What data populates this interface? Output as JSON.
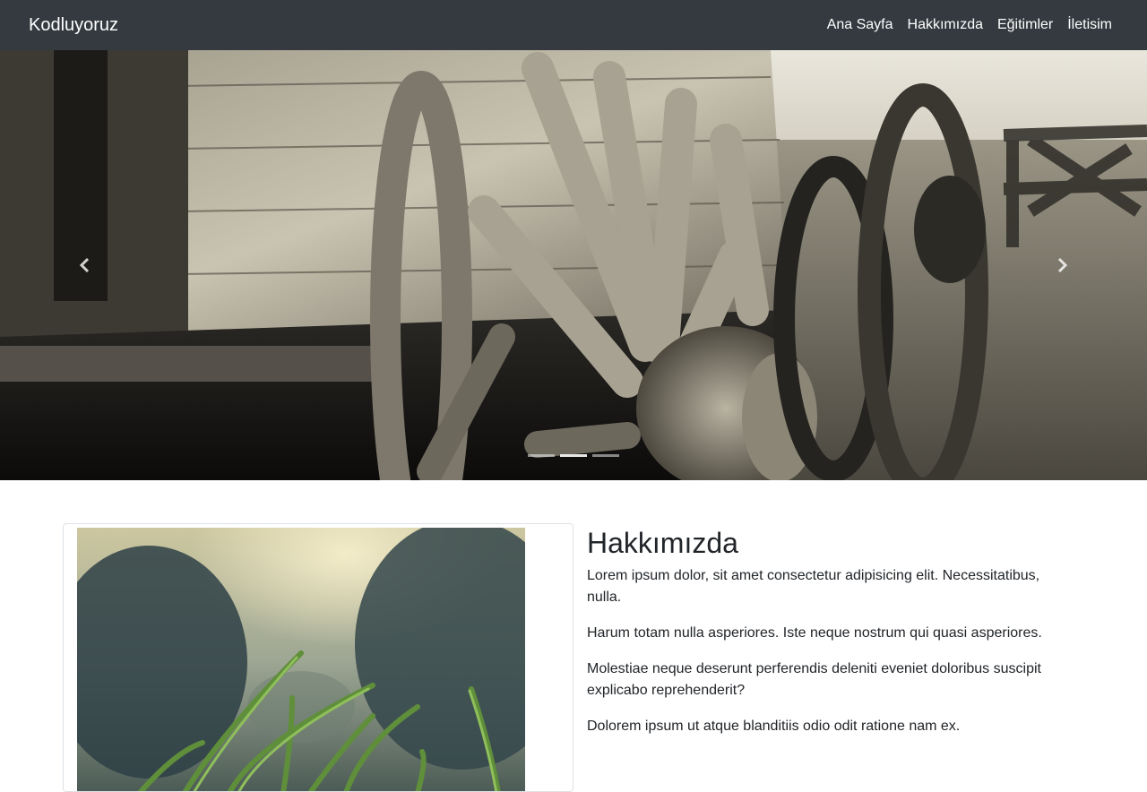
{
  "navbar": {
    "brand": "Kodluyoruz",
    "links": [
      "Ana Sayfa",
      "Hakkımızda",
      "Eğitimler",
      "İletisim"
    ]
  },
  "carousel": {
    "slide_count": 3,
    "active_index": 1,
    "prev_icon": "chevron-left-icon",
    "next_icon": "chevron-right-icon"
  },
  "about": {
    "title": "Hakkımızda",
    "paragraphs": [
      "Lorem ipsum dolor, sit amet consectetur adipisicing elit. Necessitatibus, nulla.",
      "Harum totam nulla asperiores. Iste neque nostrum qui quasi asperiores.",
      "Molestiae neque deserunt perferendis deleniti eveniet doloribus suscipit explicabo reprehenderit?",
      "Dolorem ipsum ut atque blanditiis odio odit ratione nam ex."
    ]
  },
  "colors": {
    "navbar_bg": "#343a40",
    "nav_text": "#ffffff",
    "body_text": "#212529"
  }
}
